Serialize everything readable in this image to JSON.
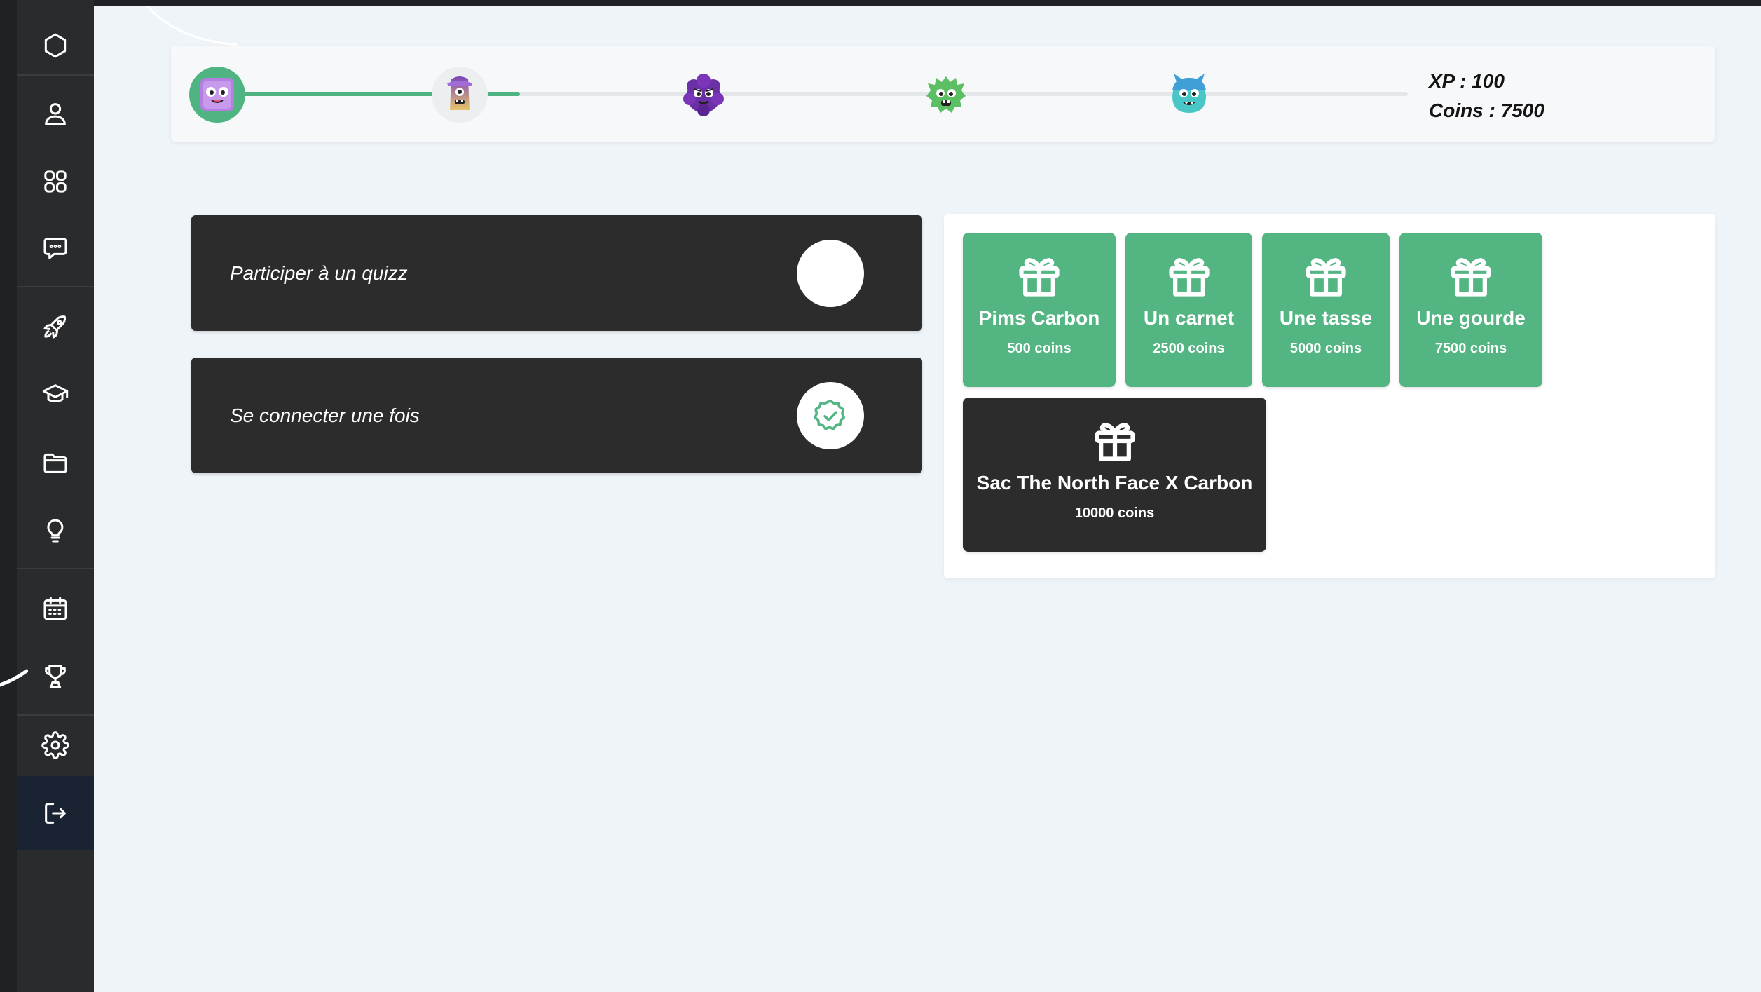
{
  "sidebar": {
    "items": [
      {
        "icon": "hexagon-icon"
      },
      {
        "icon": "user-icon"
      },
      {
        "icon": "apps-grid-icon"
      },
      {
        "icon": "chat-icon"
      },
      {
        "icon": "rocket-icon"
      },
      {
        "icon": "graduation-cap-icon"
      },
      {
        "icon": "folder-icon"
      },
      {
        "icon": "lightbulb-icon"
      },
      {
        "icon": "calendar-icon"
      },
      {
        "icon": "trophy-icon"
      },
      {
        "icon": "settings-icon"
      },
      {
        "icon": "logout-icon"
      }
    ]
  },
  "progress": {
    "levels": [
      {
        "name": "level-1",
        "state": "reached"
      },
      {
        "name": "level-2",
        "state": "reached"
      },
      {
        "name": "level-3",
        "state": "locked"
      },
      {
        "name": "level-4",
        "state": "locked"
      },
      {
        "name": "level-5",
        "state": "locked"
      }
    ],
    "progress_fraction": 0.25,
    "xp_text": "XP : 100",
    "coins_text": "Coins : 7500"
  },
  "quests": [
    {
      "label": "Participer à un quizz",
      "completed": false
    },
    {
      "label": "Se connecter une fois",
      "completed": true
    }
  ],
  "rewards": [
    {
      "name": "Pims Carbon",
      "cost": "500 coins",
      "affordable": true
    },
    {
      "name": "Un carnet",
      "cost": "2500 coins",
      "affordable": true
    },
    {
      "name": "Une tasse",
      "cost": "5000 coins",
      "affordable": true
    },
    {
      "name": "Une gourde",
      "cost": "7500 coins",
      "affordable": true
    },
    {
      "name": "Sac The North Face X Carbon",
      "cost": "10000 coins",
      "affordable": false
    }
  ],
  "colors": {
    "accent_green": "#52b582",
    "dark_card": "#2c2c2c",
    "sidebar": "#2a2b2d",
    "main_background": "#eff4f9"
  }
}
